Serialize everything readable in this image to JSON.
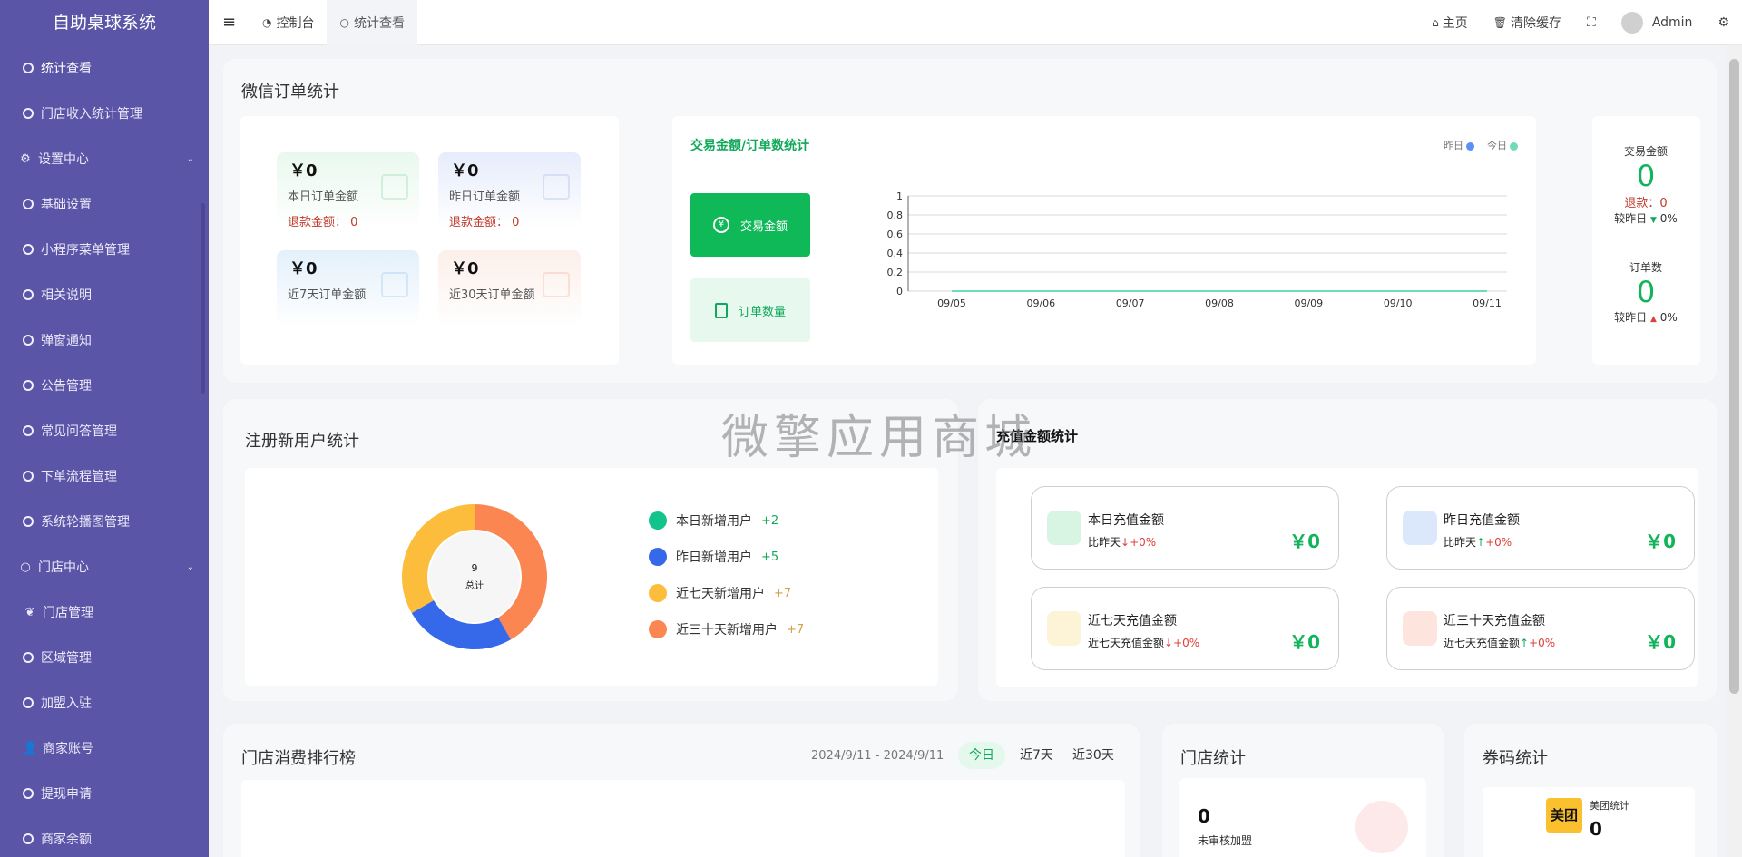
{
  "app": {
    "title": "自助桌球系统"
  },
  "sidebar": {
    "items": [
      {
        "label": "统计查看",
        "type": "dot"
      },
      {
        "label": "门店收入统计管理",
        "type": "dot"
      },
      {
        "label": "设置中心",
        "type": "group",
        "icon": "gears-icon"
      },
      {
        "label": "基础设置",
        "type": "dot"
      },
      {
        "label": "小程序菜单管理",
        "type": "dot"
      },
      {
        "label": "相关说明",
        "type": "dot"
      },
      {
        "label": "弹窗通知",
        "type": "dot"
      },
      {
        "label": "公告管理",
        "type": "dot"
      },
      {
        "label": "常见问答管理",
        "type": "dot"
      },
      {
        "label": "下单流程管理",
        "type": "dot"
      },
      {
        "label": "系统轮播图管理",
        "type": "dot"
      },
      {
        "label": "门店中心",
        "type": "group",
        "icon": "circle-icon"
      },
      {
        "label": "门店管理",
        "type": "leaf",
        "icon": "leaf-icon"
      },
      {
        "label": "区域管理",
        "type": "dot"
      },
      {
        "label": "加盟入驻",
        "type": "dot"
      },
      {
        "label": "商家账号",
        "type": "user",
        "icon": "user-icon"
      },
      {
        "label": "提现申请",
        "type": "dot"
      },
      {
        "label": "商家余额",
        "type": "dot"
      }
    ]
  },
  "topbar": {
    "tabs": [
      {
        "label": "控制台",
        "icon": "dashboard-icon"
      },
      {
        "label": "统计查看",
        "icon": "circle-icon"
      }
    ],
    "home": "主页",
    "clear_cache": "清除缓存",
    "user": "Admin"
  },
  "wechat": {
    "title": "微信订单统计",
    "boxes": [
      {
        "amount": "￥0",
        "label": "本日订单金额",
        "refund_label": "退款金额：",
        "refund_value": "0",
        "color": "#e9f8ee"
      },
      {
        "amount": "￥0",
        "label": "昨日订单金额",
        "refund_label": "退款金额：",
        "refund_value": "0",
        "color": "#e6ecfb"
      },
      {
        "amount": "￥0",
        "label": "近7天订单金额",
        "color": "#e3f0fb"
      },
      {
        "amount": "￥0",
        "label": "近30天订单金额",
        "color": "#fcefea"
      }
    ]
  },
  "trade_chart": {
    "title": "交易金额/订单数统计",
    "btn_amount": "交易金额",
    "btn_orders": "订单数量",
    "legend_yesterday": "昨日",
    "legend_today": "今日",
    "colors": {
      "yesterday": "#5b8ff9",
      "today": "#6fdcb5"
    }
  },
  "chart_data": {
    "type": "line",
    "x": [
      "09/05",
      "09/06",
      "09/07",
      "09/08",
      "09/09",
      "09/10",
      "09/11"
    ],
    "series": [
      {
        "name": "昨日",
        "values": [
          0,
          0,
          0,
          0,
          0,
          0,
          0
        ]
      },
      {
        "name": "今日",
        "values": [
          0,
          0,
          0,
          0,
          0,
          0,
          0
        ]
      }
    ],
    "yticks": [
      "0",
      "0.2",
      "0.4",
      "0.6",
      "0.8",
      "1"
    ],
    "ylim": [
      0,
      1
    ],
    "grid": true
  },
  "side_stats": {
    "trade_title": "交易金额",
    "trade_value": "0",
    "refund": "退款：0",
    "compare_label": "较昨日",
    "trade_pct": "0%",
    "order_title": "订单数",
    "order_value": "0",
    "order_pct": "0%"
  },
  "new_users": {
    "title": "注册新用户统计",
    "total": "9",
    "total_label": "总计",
    "legend": [
      {
        "label": "本日新增用户",
        "value": "+2",
        "color": "#12c48b"
      },
      {
        "label": "昨日新增用户",
        "value": "+5",
        "color": "#3569ea"
      },
      {
        "label": "近七天新增用户",
        "value": "+7",
        "color": "#fbbd3b"
      },
      {
        "label": "近三十天新增用户",
        "value": "+7",
        "color": "#fb8651"
      }
    ]
  },
  "recharge": {
    "title": "充值金额统计",
    "cards": [
      {
        "title": "本日充值金额",
        "sub": "比昨天",
        "pct": "+0%",
        "arrow": "down",
        "value": "￥0",
        "color": "#d8f5e4"
      },
      {
        "title": "昨日充值金额",
        "sub": "比昨天",
        "pct": "+0%",
        "arrow": "up",
        "value": "￥0",
        "color": "#dbe8fb"
      },
      {
        "title": "近七天充值金额",
        "sub": "近七天充值金额",
        "pct": "+0%",
        "arrow": "down",
        "value": "￥0",
        "color": "#fdf3d6"
      },
      {
        "title": "近三十天充值金额",
        "sub": "近七天充值金额",
        "pct": "+0%",
        "arrow": "up",
        "value": "￥0",
        "color": "#fde4dc"
      }
    ]
  },
  "ranking": {
    "title": "门店消费排行榜",
    "date_range": "2024/9/11 - 2024/9/11",
    "tabs": [
      "今日",
      "近7天",
      "近30天"
    ]
  },
  "store_stats": {
    "title": "门店统计",
    "value": "0",
    "label": "未审核加盟"
  },
  "coupon": {
    "title": "券码统计",
    "badge": "美团",
    "label": "美团统计",
    "value": "0"
  },
  "watermark": "微擎应用商城"
}
